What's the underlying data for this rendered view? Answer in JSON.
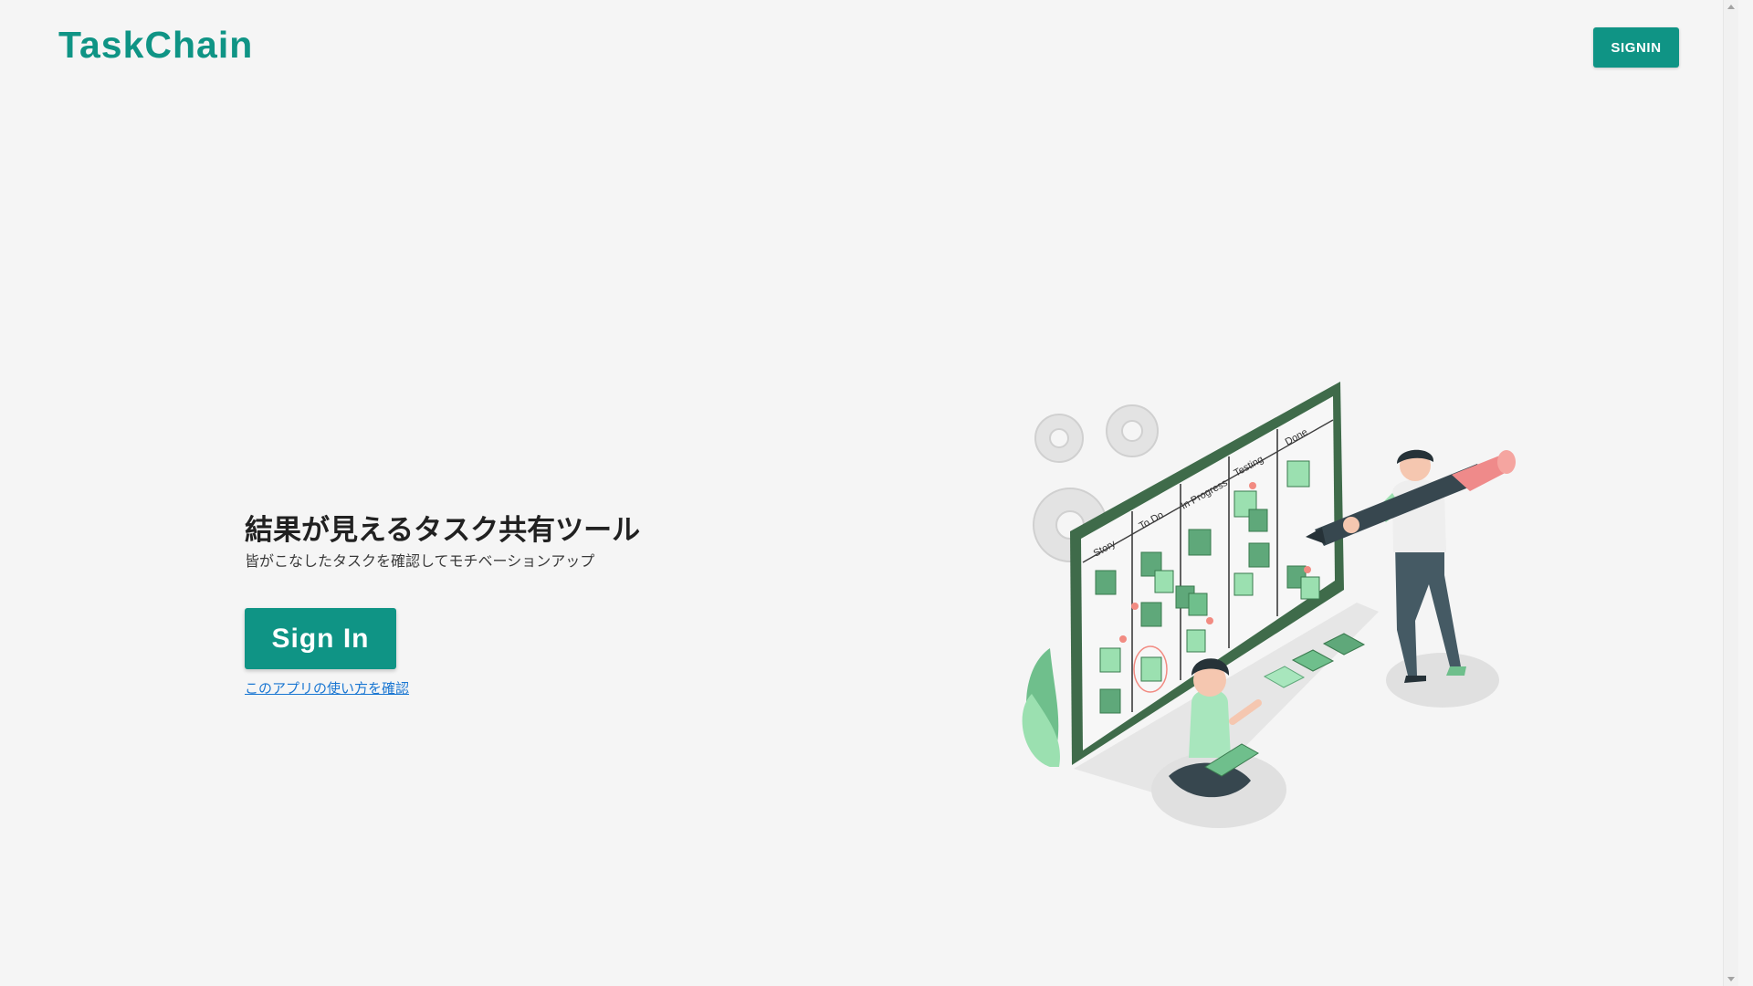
{
  "header": {
    "logo": "TaskChain",
    "signin_label": "SIGNIN"
  },
  "hero": {
    "title": "結果が見えるタスク共有ツール",
    "subtitle": "皆がこなしたタスクを確認してモチベーションアップ",
    "signin_label": "Sign In",
    "howto_link": "このアプリの使い方を確認"
  },
  "illustration": {
    "board_columns": [
      "Story",
      "To Do",
      "In Progress",
      "Testing",
      "Done"
    ]
  },
  "colors": {
    "brand": "#0f9485",
    "link": "#1976d2",
    "background": "#f5f5f5"
  }
}
